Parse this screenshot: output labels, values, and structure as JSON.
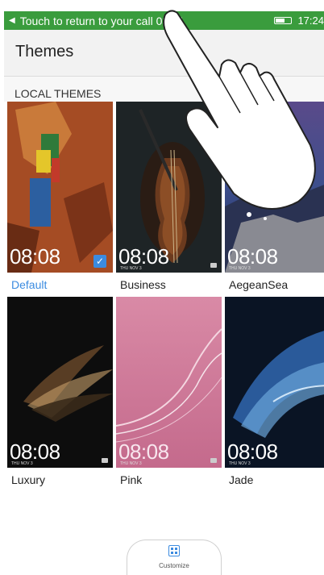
{
  "status_bar": {
    "return_text": "Touch to return to your call 03:41",
    "time": "17:24",
    "color": "#3a9c3d"
  },
  "header": {
    "title": "Themes"
  },
  "section": {
    "label": "LOCAL THEMES"
  },
  "themes": [
    {
      "name": "Default",
      "clock": "08:08",
      "date": "THU NOV 3",
      "selected": true
    },
    {
      "name": "Business",
      "clock": "08:08",
      "date": "THU NOV 3",
      "selected": false
    },
    {
      "name": "AegeanSea",
      "clock": "08:08",
      "date": "THU NOV 3",
      "selected": false
    },
    {
      "name": "Luxury",
      "clock": "08:08",
      "date": "THU NOV 3",
      "selected": false
    },
    {
      "name": "Pink",
      "clock": "08:08",
      "date": "THU NOV 3",
      "selected": false
    },
    {
      "name": "Jade",
      "clock": "08:08",
      "date": "THU NOV 3",
      "selected": false
    }
  ],
  "customize": {
    "label": "Customize",
    "icon": "grid-icon"
  },
  "accent": "#3b8be0"
}
